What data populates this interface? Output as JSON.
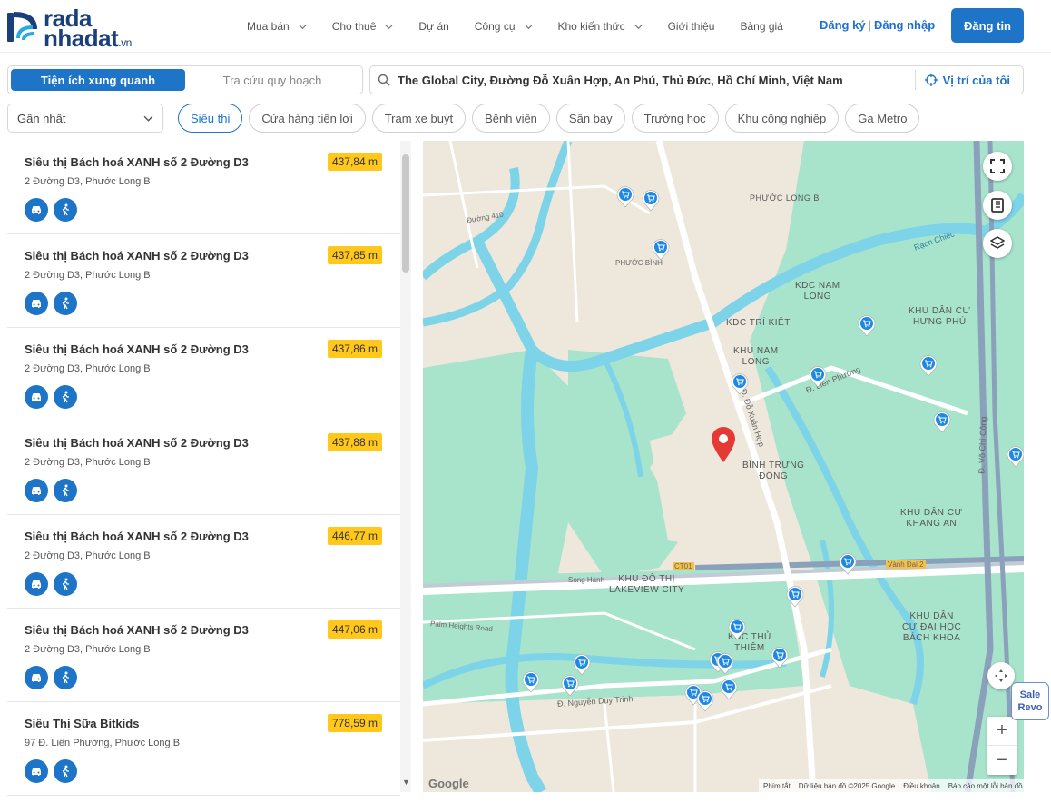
{
  "header": {
    "logo_line1": "rada",
    "logo_line2": "nhadat",
    "logo_suffix": ".vn",
    "nav": [
      {
        "label": "Mua bán",
        "has_menu": true
      },
      {
        "label": "Cho thuê",
        "has_menu": true
      },
      {
        "label": "Dự án",
        "has_menu": false
      },
      {
        "label": "Công cụ",
        "has_menu": true
      },
      {
        "label": "Kho kiến thức",
        "has_menu": true
      },
      {
        "label": "Giới thiệu",
        "has_menu": false
      },
      {
        "label": "Bảng giá",
        "has_menu": false
      }
    ],
    "register": "Đăng ký",
    "separator": "|",
    "login": "Đăng nhập",
    "post_button": "Đăng tin"
  },
  "tabs": {
    "active": "Tiện ích xung quanh",
    "inactive": "Tra cứu quy hoạch"
  },
  "search": {
    "value": "The Global City, Đường Đỗ Xuân Hợp, An Phú, Thủ Đức, Hồ Chí Minh, Việt Nam",
    "my_location": "Vị trí của tôi"
  },
  "sort": {
    "selected": "Gần nhất"
  },
  "categories": [
    "Siêu thị",
    "Cửa hàng tiện lợi",
    "Trạm xe buýt",
    "Bệnh viện",
    "Sân bay",
    "Trường học",
    "Khu công nghiệp",
    "Ga Metro"
  ],
  "results": [
    {
      "name": "Siêu thị Bách hoá XANH số 2 Đường D3",
      "distance": "437,84 m",
      "address": "2 Đường D3, Phước Long B"
    },
    {
      "name": "Siêu thị Bách hoá XANH số 2 Đường D3",
      "distance": "437,85 m",
      "address": "2 Đường D3, Phước Long B"
    },
    {
      "name": "Siêu thị Bách hoá XANH số 2 Đường D3",
      "distance": "437,86 m",
      "address": "2 Đường D3, Phước Long B"
    },
    {
      "name": "Siêu thị Bách hoá XANH số 2 Đường D3",
      "distance": "437,88 m",
      "address": "2 Đường D3, Phước Long B"
    },
    {
      "name": "Siêu thị Bách hoá XANH số 2 Đường D3",
      "distance": "446,77 m",
      "address": "2 Đường D3, Phước Long B"
    },
    {
      "name": "Siêu thị Bách hoá XANH số 2 Đường D3",
      "distance": "447,06 m",
      "address": "2 Đường D3, Phước Long B"
    },
    {
      "name": "Siêu Thị Sữa Bitkids",
      "distance": "778,59 m",
      "address": "97 Đ. Liên Phường, Phước Long B"
    }
  ],
  "map": {
    "labels": {
      "phuoc_long_b": "PHƯỚC LONG B",
      "kdc_nam_long_1": "KDC NAM",
      "kdc_nam_long_2": "LONG",
      "kdc_hung_phu_1": "KHU DÂN CƯ",
      "kdc_hung_phu_2": "HƯNG PHÚ",
      "kdc_tri_kiet": "KDC TRÍ KIỆT",
      "khu_nam_long_1": "KHU NAM",
      "khu_nam_long_2": "LONG",
      "binh_trung_dong_1": "BÌNH TRƯNG",
      "binh_trung_dong_2": "ĐÔNG",
      "kdc_khang_an_1": "KHU DÂN CƯ",
      "kdc_khang_an_2": "KHANG AN",
      "lakeview_1": "KHU ĐÔ THỊ",
      "lakeview_2": "LAKEVIEW CITY",
      "kdc_thu_thiem_1": "KDC THỦ",
      "kdc_thu_thiem_2": "THIÊM",
      "kdc_bach_khoa_1": "KHU DÂN",
      "kdc_bach_khoa_2": "CƯ ĐẠI HỌC",
      "kdc_bach_khoa_3": "BÁCH KHOA",
      "phuoc_binh": "PHƯỚC BÌNH",
      "rach_chiec": "Rạch Chiếc",
      "song_hanh": "Song Hành",
      "palm_heights": "Palm Heights Road",
      "nguyen_duy_trinh": "Đ. Nguyễn Duy Trinh",
      "lien_phuong": "Đ. Liên Phường",
      "do_xuan_hop": "Đ. Đỗ Xuân Hợp",
      "vo_chi_cong": "Đ. Võ Chí Công",
      "duong_410": "Đường 410",
      "ct01": "CT01",
      "vanh_dai_2": "Vành Đai 2"
    },
    "footer": [
      "Phím tắt",
      "Dữ liệu bản đồ ©2025 Google",
      "Điều khoản",
      "Báo cáo một lỗi bản đồ"
    ],
    "google": "Google",
    "zoom_in": "+",
    "zoom_out": "−"
  },
  "sale_badge": {
    "line1": "Sale",
    "line2": "Revo"
  },
  "colors": {
    "primary": "#1e75c8",
    "distance_badge": "#ffc81a",
    "water": "#7dd3e8",
    "green_area": "#a6e3cc",
    "pin_red": "#e53935"
  }
}
